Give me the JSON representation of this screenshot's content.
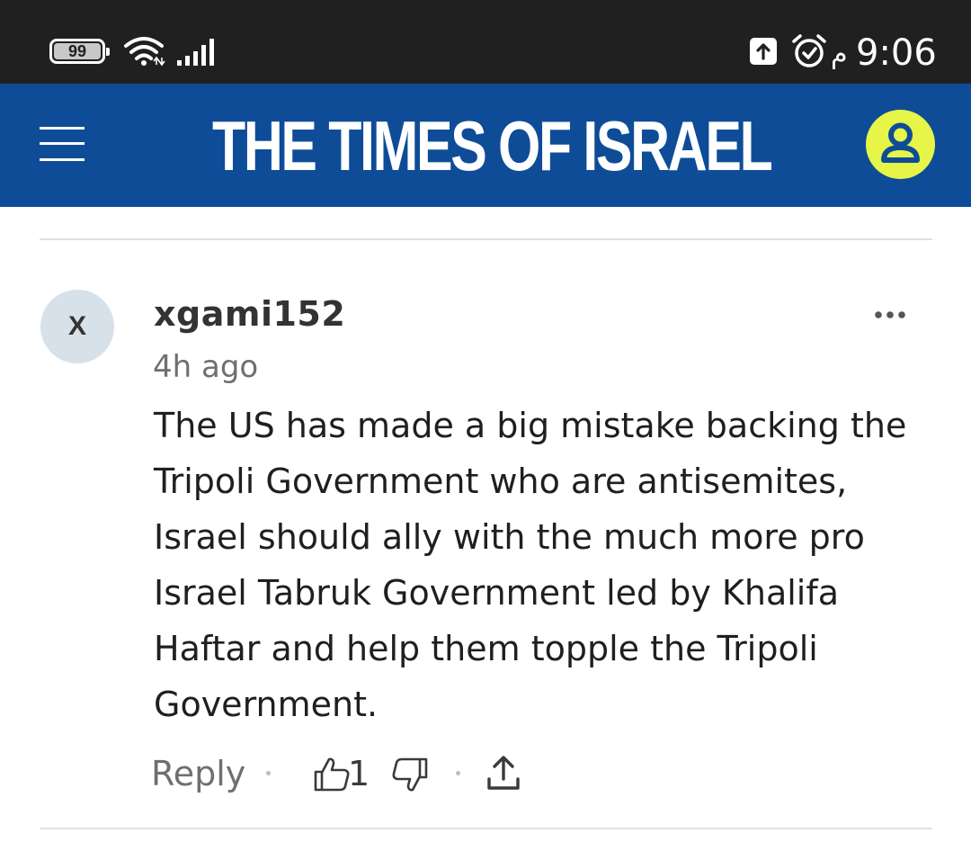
{
  "status_bar": {
    "battery_level": "99",
    "ampm": "م",
    "time": "9:06",
    "icons": [
      "battery-icon",
      "wifi-icon",
      "signal-icon",
      "upload-notification-icon",
      "alarm-icon"
    ]
  },
  "header": {
    "title": "THE TIMES OF ISRAEL",
    "background_color": "#0f4c97",
    "account_color": "#e6f548",
    "icons": [
      "menu-icon",
      "user-account-icon"
    ]
  },
  "comment": {
    "avatar_letter": "X",
    "username": "xgami152",
    "timestamp": "4h ago",
    "body": "The US has made a big mistake backing the Tripoli Government who are antisemites, Israel should ally with the much more pro Israel Tabruk Government led by Khalifa Haftar and help them topple the Tripoli Government.",
    "actions": {
      "reply_label": "Reply",
      "like_count": "1",
      "icons": [
        "more-options-icon",
        "thumbs-up-icon",
        "thumbs-down-icon",
        "share-icon"
      ]
    }
  }
}
